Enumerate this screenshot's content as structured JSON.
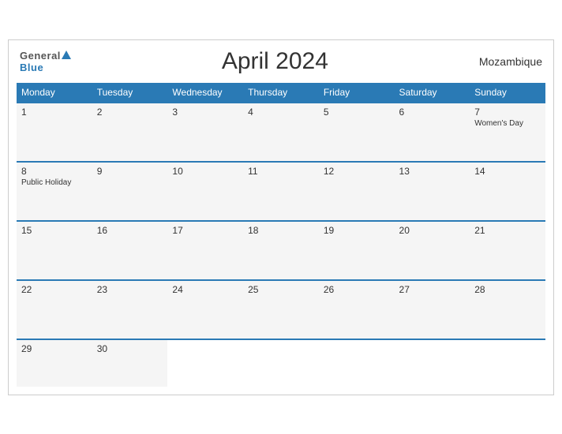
{
  "header": {
    "logo_general": "General",
    "logo_blue": "Blue",
    "title": "April 2024",
    "country": "Mozambique"
  },
  "weekdays": [
    "Monday",
    "Tuesday",
    "Wednesday",
    "Thursday",
    "Friday",
    "Saturday",
    "Sunday"
  ],
  "weeks": [
    [
      {
        "day": "1",
        "event": ""
      },
      {
        "day": "2",
        "event": ""
      },
      {
        "day": "3",
        "event": ""
      },
      {
        "day": "4",
        "event": ""
      },
      {
        "day": "5",
        "event": ""
      },
      {
        "day": "6",
        "event": ""
      },
      {
        "day": "7",
        "event": "Women's Day"
      }
    ],
    [
      {
        "day": "8",
        "event": "Public Holiday"
      },
      {
        "day": "9",
        "event": ""
      },
      {
        "day": "10",
        "event": ""
      },
      {
        "day": "11",
        "event": ""
      },
      {
        "day": "12",
        "event": ""
      },
      {
        "day": "13",
        "event": ""
      },
      {
        "day": "14",
        "event": ""
      }
    ],
    [
      {
        "day": "15",
        "event": ""
      },
      {
        "day": "16",
        "event": ""
      },
      {
        "day": "17",
        "event": ""
      },
      {
        "day": "18",
        "event": ""
      },
      {
        "day": "19",
        "event": ""
      },
      {
        "day": "20",
        "event": ""
      },
      {
        "day": "21",
        "event": ""
      }
    ],
    [
      {
        "day": "22",
        "event": ""
      },
      {
        "day": "23",
        "event": ""
      },
      {
        "day": "24",
        "event": ""
      },
      {
        "day": "25",
        "event": ""
      },
      {
        "day": "26",
        "event": ""
      },
      {
        "day": "27",
        "event": ""
      },
      {
        "day": "28",
        "event": ""
      }
    ],
    [
      {
        "day": "29",
        "event": ""
      },
      {
        "day": "30",
        "event": ""
      },
      {
        "day": "",
        "event": ""
      },
      {
        "day": "",
        "event": ""
      },
      {
        "day": "",
        "event": ""
      },
      {
        "day": "",
        "event": ""
      },
      {
        "day": "",
        "event": ""
      }
    ]
  ]
}
